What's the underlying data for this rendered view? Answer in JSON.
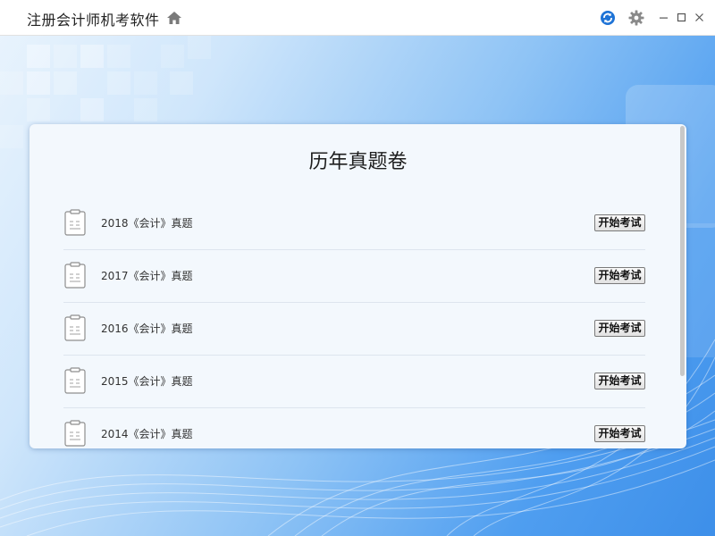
{
  "titlebar": {
    "app_title": "注册会计师机考软件",
    "icons": [
      "home-icon",
      "sync-icon",
      "gear-icon",
      "minimize-icon",
      "maximize-icon",
      "close-icon"
    ]
  },
  "main": {
    "title": "历年真题卷",
    "exams": [
      {
        "label": "2018《会计》真题",
        "button": "开始考试"
      },
      {
        "label": "2017《会计》真题",
        "button": "开始考试"
      },
      {
        "label": "2016《会计》真题",
        "button": "开始考试"
      },
      {
        "label": "2015《会计》真题",
        "button": "开始考试"
      },
      {
        "label": "2014《会计》真题",
        "button": "开始考试"
      }
    ]
  },
  "colors": {
    "background_accent": "#4f9ef0",
    "card": "#f3f8fd",
    "sync_icon": "#1e73d6"
  }
}
